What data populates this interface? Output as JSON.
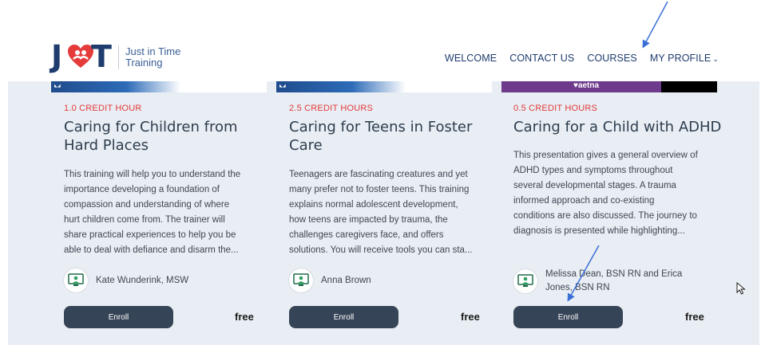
{
  "header": {
    "logo": {
      "letters_left": "J",
      "letters_right": "T",
      "line1": "Just in Time",
      "line2": "Training"
    },
    "nav": [
      {
        "label": "WELCOME"
      },
      {
        "label": "CONTACT US"
      },
      {
        "label": "COURSES"
      },
      {
        "label": "MY PROFILE"
      }
    ]
  },
  "courses": [
    {
      "credit": "1.0 CREDIT HOUR",
      "title_line1": "Caring for Children from",
      "title_line2": "Hard Places",
      "desc_lines": [
        "This training will help you to understand the",
        "importance developing a foundation of",
        "compassion and understanding of where",
        "hurt children come from. The trainer will",
        "share practical experiences to help you be",
        "able to deal with defiance and disarm the..."
      ],
      "instructor_line1": "Kate Wunderink, MSW",
      "enroll_label": "Enroll",
      "price": "free"
    },
    {
      "credit": "2.5 CREDIT HOURS",
      "title_line1": "Caring for Teens in Foster",
      "title_line2": "Care",
      "desc_lines": [
        "Teenagers are fascinating creatures and yet",
        "many prefer not to foster teens. This training",
        "explains normal adolescent development,",
        "how teens are impacted by trauma, the",
        "challenges caregivers face, and offers",
        "solutions. You will receive tools you can sta..."
      ],
      "instructor_line1": "Anna Brown",
      "enroll_label": "Enroll",
      "price": "free"
    },
    {
      "credit": "0.5 CREDIT HOURS",
      "title_line1": "Caring for a Child with ADHD",
      "desc_lines": [
        "This presentation gives a general overview of",
        "ADHD types and symptoms throughout",
        "several developmental stages. A trauma",
        "informed approach and co-existing",
        "conditions are also discussed. The journey to",
        "diagnosis is presented while highlighting..."
      ],
      "instructor_line1": "Melissa Dean, BSN RN and Erica",
      "instructor_line2": "Jones, BSN RN",
      "enroll_label": "Enroll",
      "price": "free",
      "thumb_brand": "♥aetna"
    }
  ],
  "colors": {
    "accent_red": "#e23a3a",
    "navy": "#1f3c6e",
    "button": "#364457",
    "panel_bg": "#e9eef4",
    "arrow": "#3b6fd6"
  }
}
